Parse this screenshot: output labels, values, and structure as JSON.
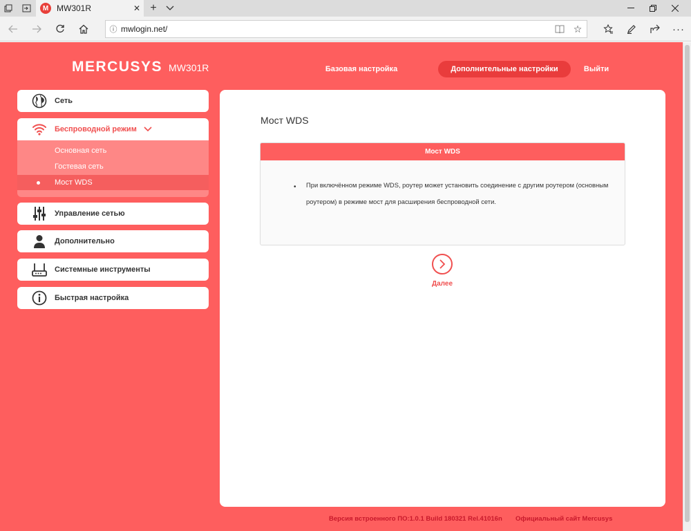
{
  "browser": {
    "tab_title": "MW301R",
    "tab_favicon_letter": "M",
    "url": "mwlogin.net/"
  },
  "header": {
    "logo_brand": "MERCUSYS",
    "logo_model": "MW301R",
    "nav_basic": "Базовая настройка",
    "nav_advanced": "Дополнительные настройки",
    "nav_logout": "Выйти"
  },
  "sidebar": {
    "items": [
      {
        "label": "Сеть",
        "icon": "globe-icon"
      },
      {
        "label": "Беспроводной режим",
        "icon": "wifi-icon"
      },
      {
        "label": "Управление сетью",
        "icon": "sliders-icon"
      },
      {
        "label": "Дополнительно",
        "icon": "user-icon"
      },
      {
        "label": "Системные инструменты",
        "icon": "router-icon"
      },
      {
        "label": "Быстрая настройка",
        "icon": "info-icon"
      }
    ],
    "subitems": [
      {
        "label": "Основная сеть"
      },
      {
        "label": "Гостевая сеть"
      },
      {
        "label": "Мост WDS"
      }
    ]
  },
  "content": {
    "title": "Мост WDS",
    "panel_header": "Мост WDS",
    "panel_bullet": "•",
    "panel_text": "При включённом режиме WDS, роутер может установить соединение с другим роутером (основным роутером) в режиме мост для расширения беспроводной сети.",
    "next_label": "Далее"
  },
  "footer": {
    "firmware": "Версия встроенного ПО:1.0.1 Build 180321 Rel.41016n",
    "official_site": "Официальный сайт Mercusys"
  },
  "colors": {
    "brand_red": "#fe5e5e",
    "active_pill": "#e93c3c",
    "submenu_bg": "#fe8786",
    "accent_text": "#f04f4f",
    "footer_text": "#c8192b"
  }
}
